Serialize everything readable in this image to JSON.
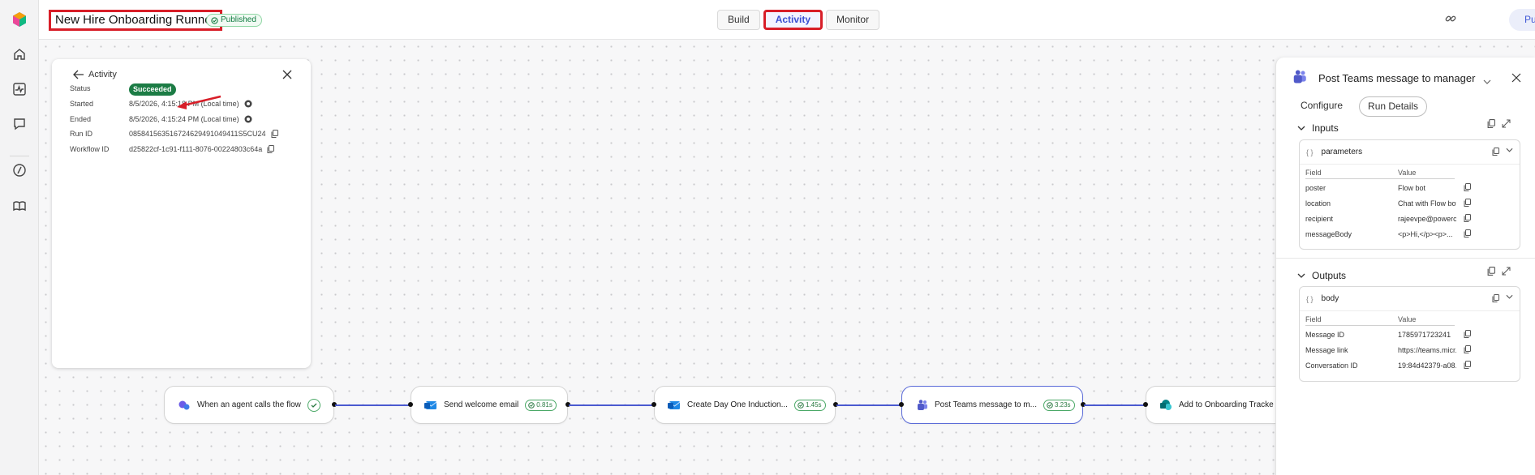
{
  "app": {
    "title": "New Hire Onboarding Runner",
    "status_badge": "Published"
  },
  "nav_tabs": [
    {
      "label": "Build",
      "active": false
    },
    {
      "label": "Activity",
      "active": true
    },
    {
      "label": "Monitor",
      "active": false
    }
  ],
  "publish_label": "Publish",
  "colors": {
    "accent": "#4b5ad0",
    "success": "#1c7c45",
    "highlight": "#d81e28"
  },
  "activity_panel": {
    "back_label": "Activity",
    "rows": [
      {
        "key": "Status",
        "value": "Succeeded"
      },
      {
        "key": "Started",
        "value": "8/5/2026, 4:15:18 PM (Local time)"
      },
      {
        "key": "Ended",
        "value": "8/5/2026, 4:15:24 PM (Local time)"
      },
      {
        "key": "Run ID",
        "value": "085841563516724629491049411S5CU24"
      },
      {
        "key": "Workflow ID",
        "value": "d25822cf-1c91-f111-8076-00224803c64a"
      }
    ]
  },
  "flow_nodes": [
    {
      "label": "When an agent calls the flow",
      "duration": "",
      "icon": "agent-icon"
    },
    {
      "label": "Send welcome email",
      "duration": "0.81s",
      "icon": "outlook-icon"
    },
    {
      "label": "Create Day One Induction...",
      "duration": "1.45s",
      "icon": "outlook-icon"
    },
    {
      "label": "Post Teams message to m...",
      "duration": "3.23s",
      "icon": "teams-icon"
    },
    {
      "label": "Add to Onboarding Tracke",
      "duration": "",
      "icon": "sharepoint-icon"
    }
  ],
  "details_panel": {
    "title": "Post Teams message to manager",
    "tabs": [
      {
        "label": "Configure",
        "active": false
      },
      {
        "label": "Run Details",
        "active": true
      }
    ],
    "inputs": {
      "heading": "Inputs",
      "group": "parameters",
      "col_field": "Field",
      "col_value": "Value",
      "rows": [
        {
          "field": "poster",
          "value": "Flow bot"
        },
        {
          "field": "location",
          "value": "Chat with Flow bot"
        },
        {
          "field": "recipient",
          "value": "rajeevpe@powerc..."
        },
        {
          "field": "messageBody",
          "value": "<p>Hi,</p><p>..."
        }
      ]
    },
    "outputs": {
      "heading": "Outputs",
      "group": "body",
      "col_field": "Field",
      "col_value": "Value",
      "rows": [
        {
          "field": "Message ID",
          "value": "1785971723241"
        },
        {
          "field": "Message link",
          "value": "https://teams.micr..."
        },
        {
          "field": "Conversation ID",
          "value": "19:84d42379-a08..."
        }
      ]
    }
  }
}
